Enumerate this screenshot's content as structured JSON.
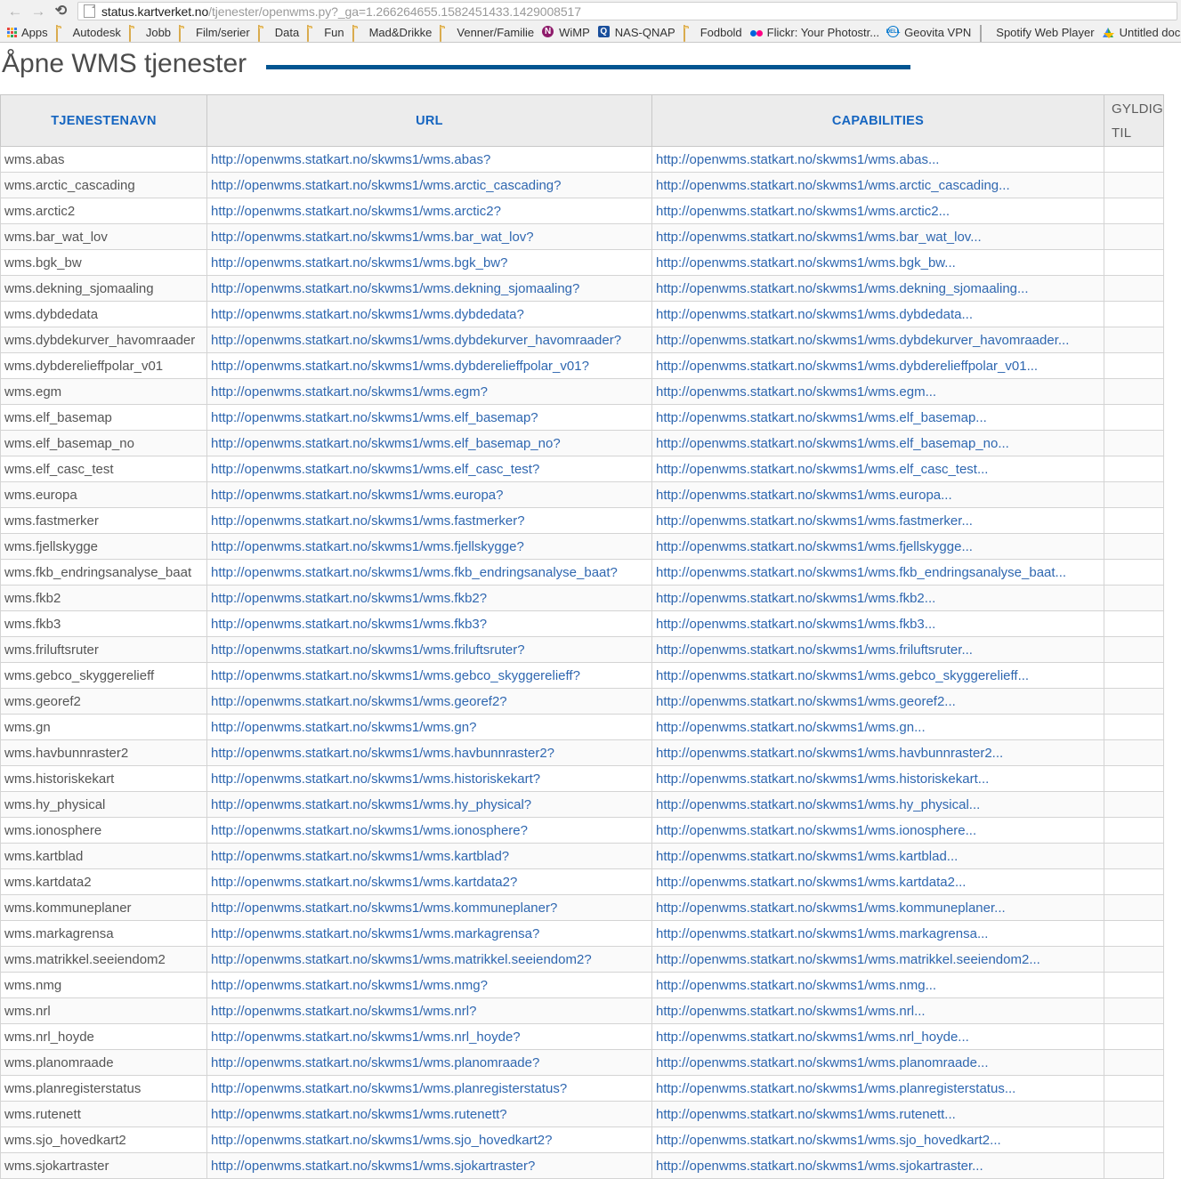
{
  "browser": {
    "back_icon": "back-arrow-icon",
    "forward_icon": "forward-arrow-icon",
    "reload_icon": "reload-icon",
    "url_host": "status.kartverket.no",
    "url_path": "/tjenester/openwms.py?_ga=1.266264655.1582451433.1429008517",
    "bookmarks": [
      {
        "label": "Apps",
        "icon": "apps-grid-icon"
      },
      {
        "label": "Autodesk",
        "icon": "folder-icon"
      },
      {
        "label": "Jobb",
        "icon": "folder-icon"
      },
      {
        "label": "Film/serier",
        "icon": "folder-icon"
      },
      {
        "label": "Data",
        "icon": "folder-icon"
      },
      {
        "label": "Fun",
        "icon": "folder-icon"
      },
      {
        "label": "Mad&Drikke",
        "icon": "folder-icon"
      },
      {
        "label": "Venner/Familie",
        "icon": "folder-icon"
      },
      {
        "label": "WiMP",
        "icon": "wimp-icon"
      },
      {
        "label": "NAS-QNAP",
        "icon": "qnap-icon"
      },
      {
        "label": "Fodbold",
        "icon": "folder-icon"
      },
      {
        "label": "Flickr: Your Photostr...",
        "icon": "flickr-dots-icon"
      },
      {
        "label": "Geovita VPN",
        "icon": "dell-icon"
      },
      {
        "label": "Spotify Web Player",
        "icon": "document-icon"
      },
      {
        "label": "Untitled doc",
        "icon": "google-drive-icon"
      }
    ]
  },
  "page": {
    "title": "Åpne WMS tjenester",
    "accent_color": "#025591",
    "header_link_color": "#2f67b0"
  },
  "table": {
    "headers": {
      "navn": "TJENESTENAVN",
      "url": "URL",
      "capabilities": "CAPABILITIES",
      "gyldig_line1": "GYLDIG",
      "gyldig_line2": "TIL"
    },
    "url_prefix": "http://openwms.statkart.no/skwms1/",
    "rows": [
      {
        "navn": "wms.abas",
        "url": "http://openwms.statkart.no/skwms1/wms.abas?",
        "capabilities": "http://openwms.statkart.no/skwms1/wms.abas...",
        "gyldig": ""
      },
      {
        "navn": "wms.arctic_cascading",
        "url": "http://openwms.statkart.no/skwms1/wms.arctic_cascading?",
        "capabilities": "http://openwms.statkart.no/skwms1/wms.arctic_cascading...",
        "gyldig": ""
      },
      {
        "navn": "wms.arctic2",
        "url": "http://openwms.statkart.no/skwms1/wms.arctic2?",
        "capabilities": "http://openwms.statkart.no/skwms1/wms.arctic2...",
        "gyldig": ""
      },
      {
        "navn": "wms.bar_wat_lov",
        "url": "http://openwms.statkart.no/skwms1/wms.bar_wat_lov?",
        "capabilities": "http://openwms.statkart.no/skwms1/wms.bar_wat_lov...",
        "gyldig": ""
      },
      {
        "navn": "wms.bgk_bw",
        "url": "http://openwms.statkart.no/skwms1/wms.bgk_bw?",
        "capabilities": "http://openwms.statkart.no/skwms1/wms.bgk_bw...",
        "gyldig": ""
      },
      {
        "navn": "wms.dekning_sjomaaling",
        "url": "http://openwms.statkart.no/skwms1/wms.dekning_sjomaaling?",
        "capabilities": "http://openwms.statkart.no/skwms1/wms.dekning_sjomaaling...",
        "gyldig": ""
      },
      {
        "navn": "wms.dybdedata",
        "url": "http://openwms.statkart.no/skwms1/wms.dybdedata?",
        "capabilities": "http://openwms.statkart.no/skwms1/wms.dybdedata...",
        "gyldig": ""
      },
      {
        "navn": "wms.dybdekurver_havomraader",
        "url": "http://openwms.statkart.no/skwms1/wms.dybdekurver_havomraader?",
        "capabilities": "http://openwms.statkart.no/skwms1/wms.dybdekurver_havomraader...",
        "gyldig": ""
      },
      {
        "navn": "wms.dybderelieffpolar_v01",
        "url": "http://openwms.statkart.no/skwms1/wms.dybderelieffpolar_v01?",
        "capabilities": "http://openwms.statkart.no/skwms1/wms.dybderelieffpolar_v01...",
        "gyldig": ""
      },
      {
        "navn": "wms.egm",
        "url": "http://openwms.statkart.no/skwms1/wms.egm?",
        "capabilities": "http://openwms.statkart.no/skwms1/wms.egm...",
        "gyldig": ""
      },
      {
        "navn": "wms.elf_basemap",
        "url": "http://openwms.statkart.no/skwms1/wms.elf_basemap?",
        "capabilities": "http://openwms.statkart.no/skwms1/wms.elf_basemap...",
        "gyldig": ""
      },
      {
        "navn": "wms.elf_basemap_no",
        "url": "http://openwms.statkart.no/skwms1/wms.elf_basemap_no?",
        "capabilities": "http://openwms.statkart.no/skwms1/wms.elf_basemap_no...",
        "gyldig": ""
      },
      {
        "navn": "wms.elf_casc_test",
        "url": "http://openwms.statkart.no/skwms1/wms.elf_casc_test?",
        "capabilities": "http://openwms.statkart.no/skwms1/wms.elf_casc_test...",
        "gyldig": ""
      },
      {
        "navn": "wms.europa",
        "url": "http://openwms.statkart.no/skwms1/wms.europa?",
        "capabilities": "http://openwms.statkart.no/skwms1/wms.europa...",
        "gyldig": ""
      },
      {
        "navn": "wms.fastmerker",
        "url": "http://openwms.statkart.no/skwms1/wms.fastmerker?",
        "capabilities": "http://openwms.statkart.no/skwms1/wms.fastmerker...",
        "gyldig": ""
      },
      {
        "navn": "wms.fjellskygge",
        "url": "http://openwms.statkart.no/skwms1/wms.fjellskygge?",
        "capabilities": "http://openwms.statkart.no/skwms1/wms.fjellskygge...",
        "gyldig": ""
      },
      {
        "navn": "wms.fkb_endringsanalyse_baat",
        "url": "http://openwms.statkart.no/skwms1/wms.fkb_endringsanalyse_baat?",
        "capabilities": "http://openwms.statkart.no/skwms1/wms.fkb_endringsanalyse_baat...",
        "gyldig": ""
      },
      {
        "navn": "wms.fkb2",
        "url": "http://openwms.statkart.no/skwms1/wms.fkb2?",
        "capabilities": "http://openwms.statkart.no/skwms1/wms.fkb2...",
        "gyldig": ""
      },
      {
        "navn": "wms.fkb3",
        "url": "http://openwms.statkart.no/skwms1/wms.fkb3?",
        "capabilities": "http://openwms.statkart.no/skwms1/wms.fkb3...",
        "gyldig": ""
      },
      {
        "navn": "wms.friluftsruter",
        "url": "http://openwms.statkart.no/skwms1/wms.friluftsruter?",
        "capabilities": "http://openwms.statkart.no/skwms1/wms.friluftsruter...",
        "gyldig": ""
      },
      {
        "navn": "wms.gebco_skyggerelieff",
        "url": "http://openwms.statkart.no/skwms1/wms.gebco_skyggerelieff?",
        "capabilities": "http://openwms.statkart.no/skwms1/wms.gebco_skyggerelieff...",
        "gyldig": ""
      },
      {
        "navn": "wms.georef2",
        "url": "http://openwms.statkart.no/skwms1/wms.georef2?",
        "capabilities": "http://openwms.statkart.no/skwms1/wms.georef2...",
        "gyldig": ""
      },
      {
        "navn": "wms.gn",
        "url": "http://openwms.statkart.no/skwms1/wms.gn?",
        "capabilities": "http://openwms.statkart.no/skwms1/wms.gn...",
        "gyldig": ""
      },
      {
        "navn": "wms.havbunnraster2",
        "url": "http://openwms.statkart.no/skwms1/wms.havbunnraster2?",
        "capabilities": "http://openwms.statkart.no/skwms1/wms.havbunnraster2...",
        "gyldig": ""
      },
      {
        "navn": "wms.historiskekart",
        "url": "http://openwms.statkart.no/skwms1/wms.historiskekart?",
        "capabilities": "http://openwms.statkart.no/skwms1/wms.historiskekart...",
        "gyldig": ""
      },
      {
        "navn": "wms.hy_physical",
        "url": "http://openwms.statkart.no/skwms1/wms.hy_physical?",
        "capabilities": "http://openwms.statkart.no/skwms1/wms.hy_physical...",
        "gyldig": ""
      },
      {
        "navn": "wms.ionosphere",
        "url": "http://openwms.statkart.no/skwms1/wms.ionosphere?",
        "capabilities": "http://openwms.statkart.no/skwms1/wms.ionosphere...",
        "gyldig": ""
      },
      {
        "navn": "wms.kartblad",
        "url": "http://openwms.statkart.no/skwms1/wms.kartblad?",
        "capabilities": "http://openwms.statkart.no/skwms1/wms.kartblad...",
        "gyldig": ""
      },
      {
        "navn": "wms.kartdata2",
        "url": "http://openwms.statkart.no/skwms1/wms.kartdata2?",
        "capabilities": "http://openwms.statkart.no/skwms1/wms.kartdata2...",
        "gyldig": ""
      },
      {
        "navn": "wms.kommuneplaner",
        "url": "http://openwms.statkart.no/skwms1/wms.kommuneplaner?",
        "capabilities": "http://openwms.statkart.no/skwms1/wms.kommuneplaner...",
        "gyldig": ""
      },
      {
        "navn": "wms.markagrensa",
        "url": "http://openwms.statkart.no/skwms1/wms.markagrensa?",
        "capabilities": "http://openwms.statkart.no/skwms1/wms.markagrensa...",
        "gyldig": ""
      },
      {
        "navn": "wms.matrikkel.seeiendom2",
        "url": "http://openwms.statkart.no/skwms1/wms.matrikkel.seeiendom2?",
        "capabilities": "http://openwms.statkart.no/skwms1/wms.matrikkel.seeiendom2...",
        "gyldig": ""
      },
      {
        "navn": "wms.nmg",
        "url": "http://openwms.statkart.no/skwms1/wms.nmg?",
        "capabilities": "http://openwms.statkart.no/skwms1/wms.nmg...",
        "gyldig": ""
      },
      {
        "navn": "wms.nrl",
        "url": "http://openwms.statkart.no/skwms1/wms.nrl?",
        "capabilities": "http://openwms.statkart.no/skwms1/wms.nrl...",
        "gyldig": ""
      },
      {
        "navn": "wms.nrl_hoyde",
        "url": "http://openwms.statkart.no/skwms1/wms.nrl_hoyde?",
        "capabilities": "http://openwms.statkart.no/skwms1/wms.nrl_hoyde...",
        "gyldig": ""
      },
      {
        "navn": "wms.planomraade",
        "url": "http://openwms.statkart.no/skwms1/wms.planomraade?",
        "capabilities": "http://openwms.statkart.no/skwms1/wms.planomraade...",
        "gyldig": ""
      },
      {
        "navn": "wms.planregisterstatus",
        "url": "http://openwms.statkart.no/skwms1/wms.planregisterstatus?",
        "capabilities": "http://openwms.statkart.no/skwms1/wms.planregisterstatus...",
        "gyldig": ""
      },
      {
        "navn": "wms.rutenett",
        "url": "http://openwms.statkart.no/skwms1/wms.rutenett?",
        "capabilities": "http://openwms.statkart.no/skwms1/wms.rutenett...",
        "gyldig": ""
      },
      {
        "navn": "wms.sjo_hovedkart2",
        "url": "http://openwms.statkart.no/skwms1/wms.sjo_hovedkart2?",
        "capabilities": "http://openwms.statkart.no/skwms1/wms.sjo_hovedkart2...",
        "gyldig": ""
      },
      {
        "navn": "wms.sjokartraster",
        "url": "http://openwms.statkart.no/skwms1/wms.sjokartraster?",
        "capabilities": "http://openwms.statkart.no/skwms1/wms.sjokartraster...",
        "gyldig": ""
      }
    ]
  }
}
